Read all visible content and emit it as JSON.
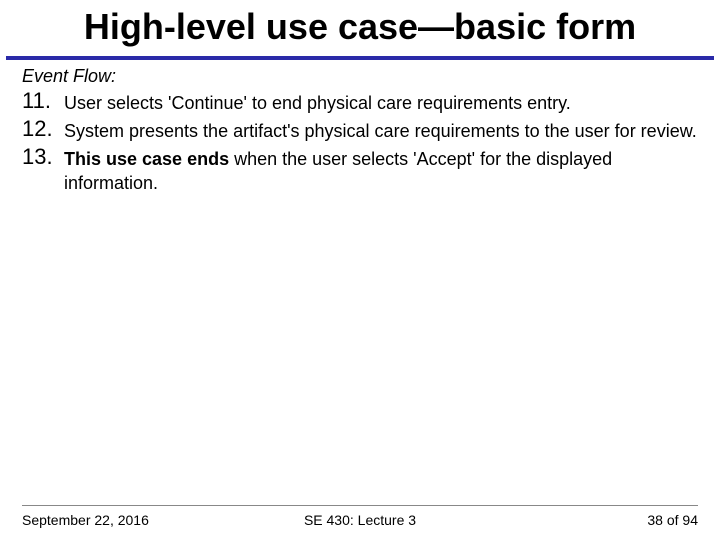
{
  "title": "High-level use case—basic form",
  "section_label": "Event Flow:",
  "items": [
    {
      "num": "11.",
      "text": "User selects 'Continue' to end physical care requirements entry."
    },
    {
      "num": "12.",
      "text": "System presents the artifact's physical care requirements to the user for review."
    },
    {
      "num": "13.",
      "bold_prefix": "This use case ends",
      "rest": " when the user selects 'Accept' for the displayed information."
    }
  ],
  "footer": {
    "date": "September 22, 2016",
    "course": "SE 430: Lecture 3",
    "page": "38 of 94"
  }
}
